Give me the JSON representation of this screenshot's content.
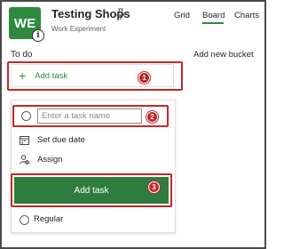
{
  "header": {
    "avatar_initials": "WE",
    "info_badge": "i",
    "plan_title": "Testing Shops",
    "plan_subtitle": "Work Experiment",
    "tabs": [
      {
        "label": "Grid",
        "active": false
      },
      {
        "label": "Board",
        "active": true
      },
      {
        "label": "Charts",
        "active": false
      }
    ]
  },
  "bucket": {
    "title": "To do",
    "add_new_bucket": "Add new bucket",
    "add_task_label": "Add task"
  },
  "task_card": {
    "name_placeholder": "Enter a task name",
    "set_due_date": "Set due date",
    "assign": "Assign",
    "add_task_button": "Add task",
    "priority_label": "Regular"
  },
  "annotations": [
    "1",
    "2",
    "3"
  ],
  "colors": {
    "accent_green": "#2f8a3e",
    "button_green": "#2e7d3e",
    "highlight_red": "#c0282b"
  },
  "icons": [
    "pin-icon",
    "plus-icon",
    "calendar-icon",
    "assign-person-icon"
  ]
}
